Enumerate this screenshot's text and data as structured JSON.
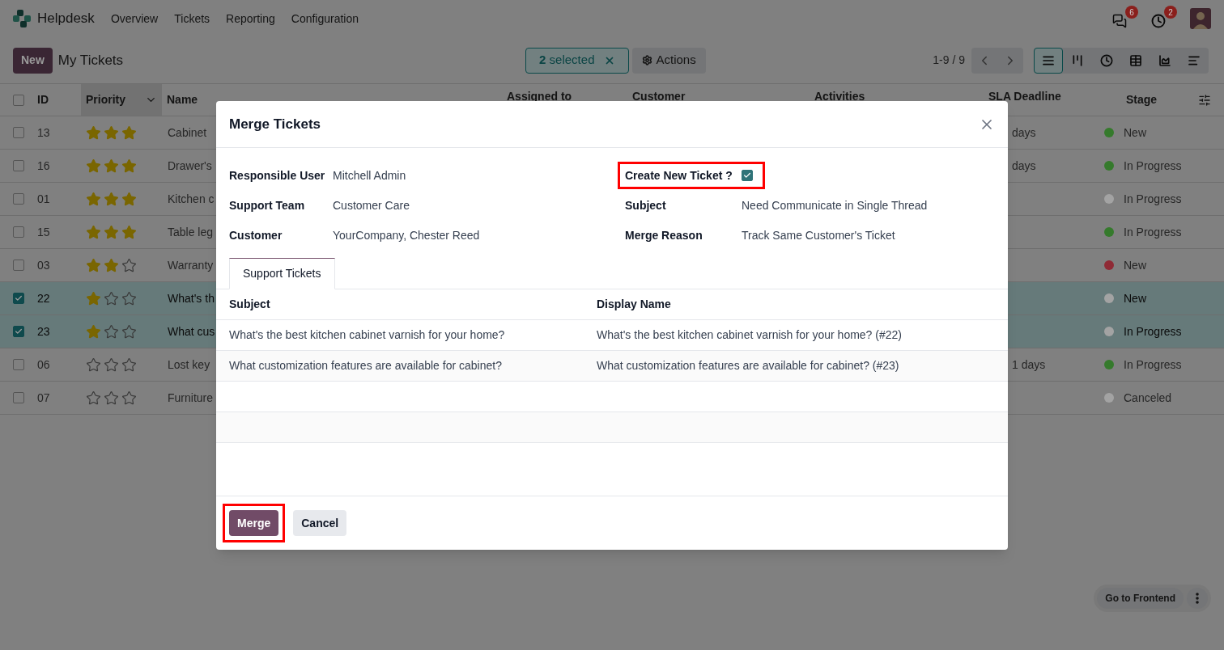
{
  "app": {
    "name": "Helpdesk",
    "menu": [
      "Overview",
      "Tickets",
      "Reporting",
      "Configuration"
    ],
    "messages_badge": "6",
    "activities_badge": "2"
  },
  "control_panel": {
    "new_button": "New",
    "title": "My Tickets",
    "selection": "**2** selected",
    "actions": "Actions",
    "pager": "1-9 / 9",
    "views": [
      {
        "kind": "list",
        "selected": true
      },
      {
        "kind": "kanban",
        "selected": false
      },
      {
        "kind": "activity",
        "selected": false
      },
      {
        "kind": "pivot",
        "selected": false
      },
      {
        "kind": "graph",
        "selected": false
      },
      {
        "kind": "gantt",
        "selected": false
      }
    ]
  },
  "list": {
    "select_all": {
      "checked": false
    },
    "columns": [
      "ID",
      "Priority",
      "Name",
      "Assigned to",
      "Customer",
      "Activities",
      "SLA Deadline",
      "Stage"
    ],
    "rows": [
      {
        "id": "13",
        "stars": 3,
        "name": "Cabinet",
        "sla": "days",
        "stage": "New",
        "color": "#357a2c",
        "selected": false
      },
      {
        "id": "16",
        "stars": 3,
        "name": "Drawer's",
        "sla": "days",
        "stage": "In Progress",
        "color": "#357a2c",
        "selected": false
      },
      {
        "id": "01",
        "stars": 3,
        "name": "Kitchen c",
        "stage": "In Progress",
        "color": "#a3a3a3",
        "selected": false
      },
      {
        "id": "15",
        "stars": 3,
        "name": "Table leg",
        "stage": "In Progress",
        "color": "#357a2c",
        "selected": false
      },
      {
        "id": "03",
        "stars": 2,
        "name": "Warranty",
        "stage": "New",
        "color": "#8f2a35",
        "selected": false
      },
      {
        "id": "22",
        "stars": 1,
        "name": "What's th",
        "stage": "New",
        "color": "#a3a3a3",
        "selected": true
      },
      {
        "id": "23",
        "stars": 1,
        "name": "What cus",
        "stage": "In Progress",
        "color": "#a3a3a3",
        "selected": true
      },
      {
        "id": "06",
        "stars": 0,
        "name": "Lost key",
        "sla": "1 days",
        "stage": "In Progress",
        "color": "#357a2c",
        "selected": false
      },
      {
        "id": "07",
        "stars": 0,
        "name": "Furniture",
        "stage": "Canceled",
        "color": "#a3a3a3",
        "selected": false
      }
    ]
  },
  "dialog": {
    "title": "Merge Tickets",
    "left_fields": [
      {
        "label": "Responsible User",
        "value": "Mitchell Admin"
      },
      {
        "label": "Support Team",
        "value": "Customer Care"
      },
      {
        "label": "Customer",
        "value": "YourCompany, Chester Reed"
      }
    ],
    "create_new_ticket": {
      "label": "Create New Ticket ?",
      "checked": true,
      "highlighted": true
    },
    "right_fields": [
      {
        "label": "Subject",
        "value": "Need Communicate in Single Thread"
      },
      {
        "label": "Merge Reason",
        "value": "Track Same Customer's Ticket"
      }
    ],
    "tabs": [
      {
        "label": "Support Tickets",
        "selected": true
      }
    ],
    "table": {
      "columns": [
        "Subject",
        "Display Name"
      ],
      "rows": [
        [
          "What's the best kitchen cabinet varnish for your home?",
          "What's the best kitchen cabinet varnish for your home? (#22)"
        ],
        [
          "What customization features are available for cabinet?",
          "What customization features are available for cabinet? (#23)"
        ]
      ]
    },
    "buttons": [
      {
        "label": "Merge",
        "kind": "primary",
        "highlighted": true
      },
      {
        "label": "Cancel",
        "kind": "secondary",
        "highlighted": false
      }
    ]
  },
  "floating": {
    "label": "Go to Frontend"
  }
}
